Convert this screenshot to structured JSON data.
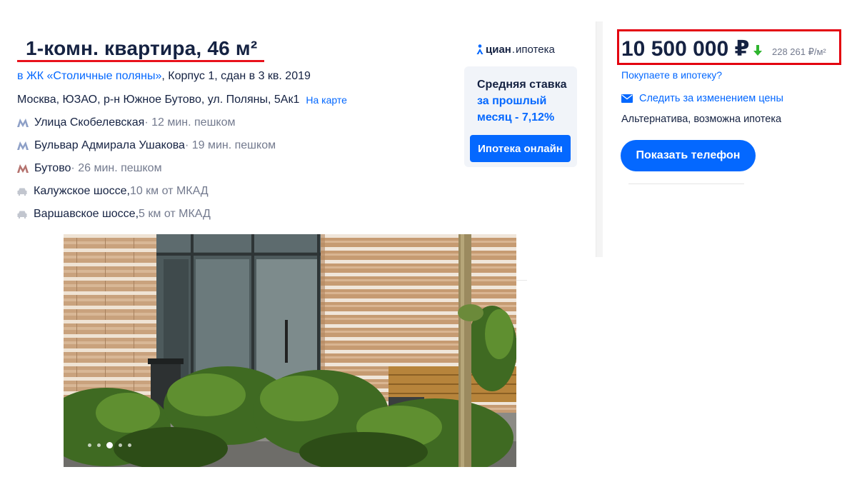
{
  "listing": {
    "title": "1-комн. квартира, 46 м²",
    "complex_link": "в ЖК «Столичные поляны»",
    "complex_details": ", Корпус 1, сдан в 3 кв. 2019",
    "address": "Москва, ЮЗАО, р-н Южное Бутово, ул. Поляны, 5Ак1",
    "map_link": "На карте",
    "metro": [
      {
        "station": "Улица Скобелевская",
        "time": " · 12 мин. пешком",
        "color": "#8ea0c7"
      },
      {
        "station": "Бульвар Адмирала Ушакова",
        "time": " · 19 мин. пешком",
        "color": "#8ea0c7"
      },
      {
        "station": "Бутово",
        "time": " · 26 мин. пешком",
        "color": "#b5736f"
      }
    ],
    "highways": [
      {
        "name": "Калужское шоссе,",
        "distance": " 10 км от МКАД"
      },
      {
        "name": "Варшавское шоссе,",
        "distance": " 5 км от МКАД"
      }
    ],
    "photo": {
      "slide_count": 5,
      "active_slide": 3,
      "icon": "building-photo"
    }
  },
  "mortgage": {
    "brand": "циан",
    "brand_suffix": "ипотека",
    "rate_title": "Средняя ставка",
    "rate_period": "за прошлый месяц - 7,12%",
    "button": "Ипотека онлайн"
  },
  "offer": {
    "price": "10 500 000 ₽",
    "price_trend_icon": "arrow-down-icon",
    "price_per_meter": "228 261 ₽/м²",
    "mortgage_question": "Покупаете в ипотеку?",
    "watch_price": "Следить за изменением цены",
    "deal_type": "Альтернатива, возможна ипотека",
    "phone_button": "Показать телефон"
  },
  "colors": {
    "accent": "#0468ff",
    "text": "#152242",
    "muted": "#737a8e",
    "highlight": "#e3000f",
    "trend_down": "#2fb52f"
  }
}
